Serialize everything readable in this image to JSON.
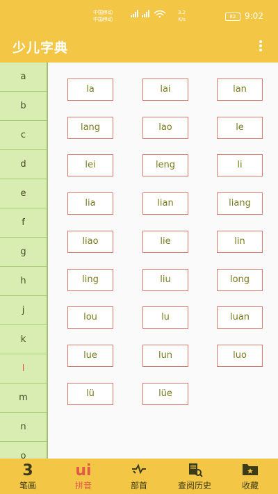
{
  "status": {
    "carrier1": "中国移动",
    "carrier2": "中国移动",
    "speed_value": "3.2",
    "speed_unit": "K/s",
    "battery": "82",
    "time": "9:02"
  },
  "appbar": {
    "title": "少儿字典"
  },
  "sidebar": {
    "letters": [
      "a",
      "b",
      "c",
      "d",
      "e",
      "f",
      "g",
      "h",
      "j",
      "k",
      "l",
      "m",
      "n",
      "o"
    ],
    "active": "l"
  },
  "syllables": [
    "la",
    "lai",
    "lan",
    "lang",
    "lao",
    "le",
    "lei",
    "leng",
    "li",
    "lia",
    "lian",
    "liang",
    "liao",
    "lie",
    "lin",
    "ling",
    "liu",
    "long",
    "lou",
    "lu",
    "luan",
    "lue",
    "lun",
    "luo",
    "lü",
    "lüe"
  ],
  "tabs": [
    {
      "label": "笔画",
      "icon": "stroke-number-icon",
      "glyph": "3"
    },
    {
      "label": "拼音",
      "icon": "pinyin-icon",
      "glyph": "ui"
    },
    {
      "label": "部首",
      "icon": "radical-icon",
      "glyph": ""
    },
    {
      "label": "查阅历史",
      "icon": "history-icon",
      "glyph": ""
    },
    {
      "label": "收藏",
      "icon": "favorites-folder-icon",
      "glyph": ""
    }
  ],
  "active_tab": "拼音",
  "colors": {
    "primary": "#f3c646",
    "sidebar": "#d9edb2",
    "accent": "#e05a4a",
    "cell_border": "#d9776a"
  }
}
